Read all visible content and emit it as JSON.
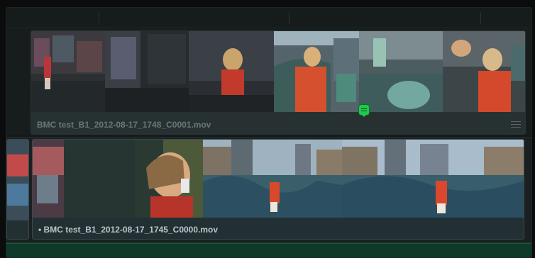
{
  "timeline": {
    "clips": [
      {
        "name": "BMC test_B1_2012-08-17_1748_C0001.mov"
      },
      {
        "name": "• BMC test_B1_2012-08-17_1745_C0000.mov"
      }
    ],
    "colors": {
      "background": "#141819",
      "clip_gray": "#283132",
      "clip_teal": "#233033",
      "marker_green": "#1ec84a",
      "audio_track": "#0d3a29"
    },
    "icons": [
      "menu-icon",
      "comment-marker-icon"
    ]
  }
}
